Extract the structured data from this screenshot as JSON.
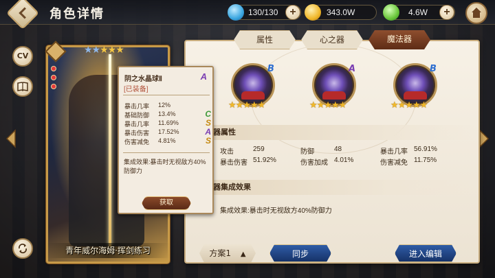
{
  "header": {
    "title": "角色详情",
    "resources": [
      {
        "name": "stamina",
        "icon": "water-drop-icon",
        "value": "130/130",
        "color": "#3aa6e0"
      },
      {
        "name": "gold",
        "icon": "gold-coin-icon",
        "value": "343.0W",
        "color": "#f0b72a"
      },
      {
        "name": "gem",
        "icon": "green-leaf-gem-icon",
        "value": "4.6W",
        "color": "#69c53a"
      }
    ]
  },
  "sidebar": {
    "cv_label": "CV"
  },
  "character": {
    "name": "青年威尔海姆·挥剑练习",
    "stars_blue": "★★",
    "stars_gold": "★★★"
  },
  "tooltip": {
    "item_name": "阴之水晶球Ⅱ",
    "grade": "A",
    "equipped": "[已装备]",
    "stats": [
      {
        "label": "暴击几率",
        "value": "12%",
        "grade": "",
        "grade_color": ""
      },
      {
        "label": "基础防御",
        "value": "13.4%",
        "grade": "C",
        "grade_color": "#3f9a3a"
      },
      {
        "label": "暴击几率",
        "value": "11.69%",
        "grade": "S",
        "grade_color": "#c58a12"
      },
      {
        "label": "暴击伤害",
        "value": "17.52%",
        "grade": "A",
        "grade_color": "#7b3fb2"
      },
      {
        "label": "伤害减免",
        "value": "4.81%",
        "grade": "S",
        "grade_color": "#c58a12"
      }
    ],
    "effect": "集成效果:暴击时无视敌方40%防御力",
    "acquire_label": "获取"
  },
  "tabs": [
    {
      "label": "属性",
      "active": false
    },
    {
      "label": "心之器",
      "active": false
    },
    {
      "label": "魔法器",
      "active": true
    }
  ],
  "artifacts": [
    {
      "grade": "B",
      "grade_color": "#2f6fd0",
      "stars": "★★★★★"
    },
    {
      "grade": "A",
      "grade_color": "#7b3fb2",
      "stars": "★★★★★"
    },
    {
      "grade": "B",
      "grade_color": "#2f6fd0",
      "stars": "★★★★★"
    }
  ],
  "attributes": {
    "heading": "魔法器属性",
    "rows": [
      [
        {
          "label": "攻击",
          "value": "259"
        },
        {
          "label": "防御",
          "value": "48"
        },
        {
          "label": "暴击几率",
          "value": "56.91%"
        }
      ],
      [
        {
          "label": "暴击伤害",
          "value": "51.92%"
        },
        {
          "label": "伤害加成",
          "value": "4.01%"
        },
        {
          "label": "伤害减免",
          "value": "11.75%"
        }
      ]
    ]
  },
  "set_effect": {
    "heading": "魔法器集成效果",
    "text": "集成效果:暴击时无视敌方40%防御力"
  },
  "footer": {
    "plan_label": "方案1",
    "plan_arrow": "▲",
    "sync_label": "同步",
    "edit_label": "进入编辑"
  }
}
